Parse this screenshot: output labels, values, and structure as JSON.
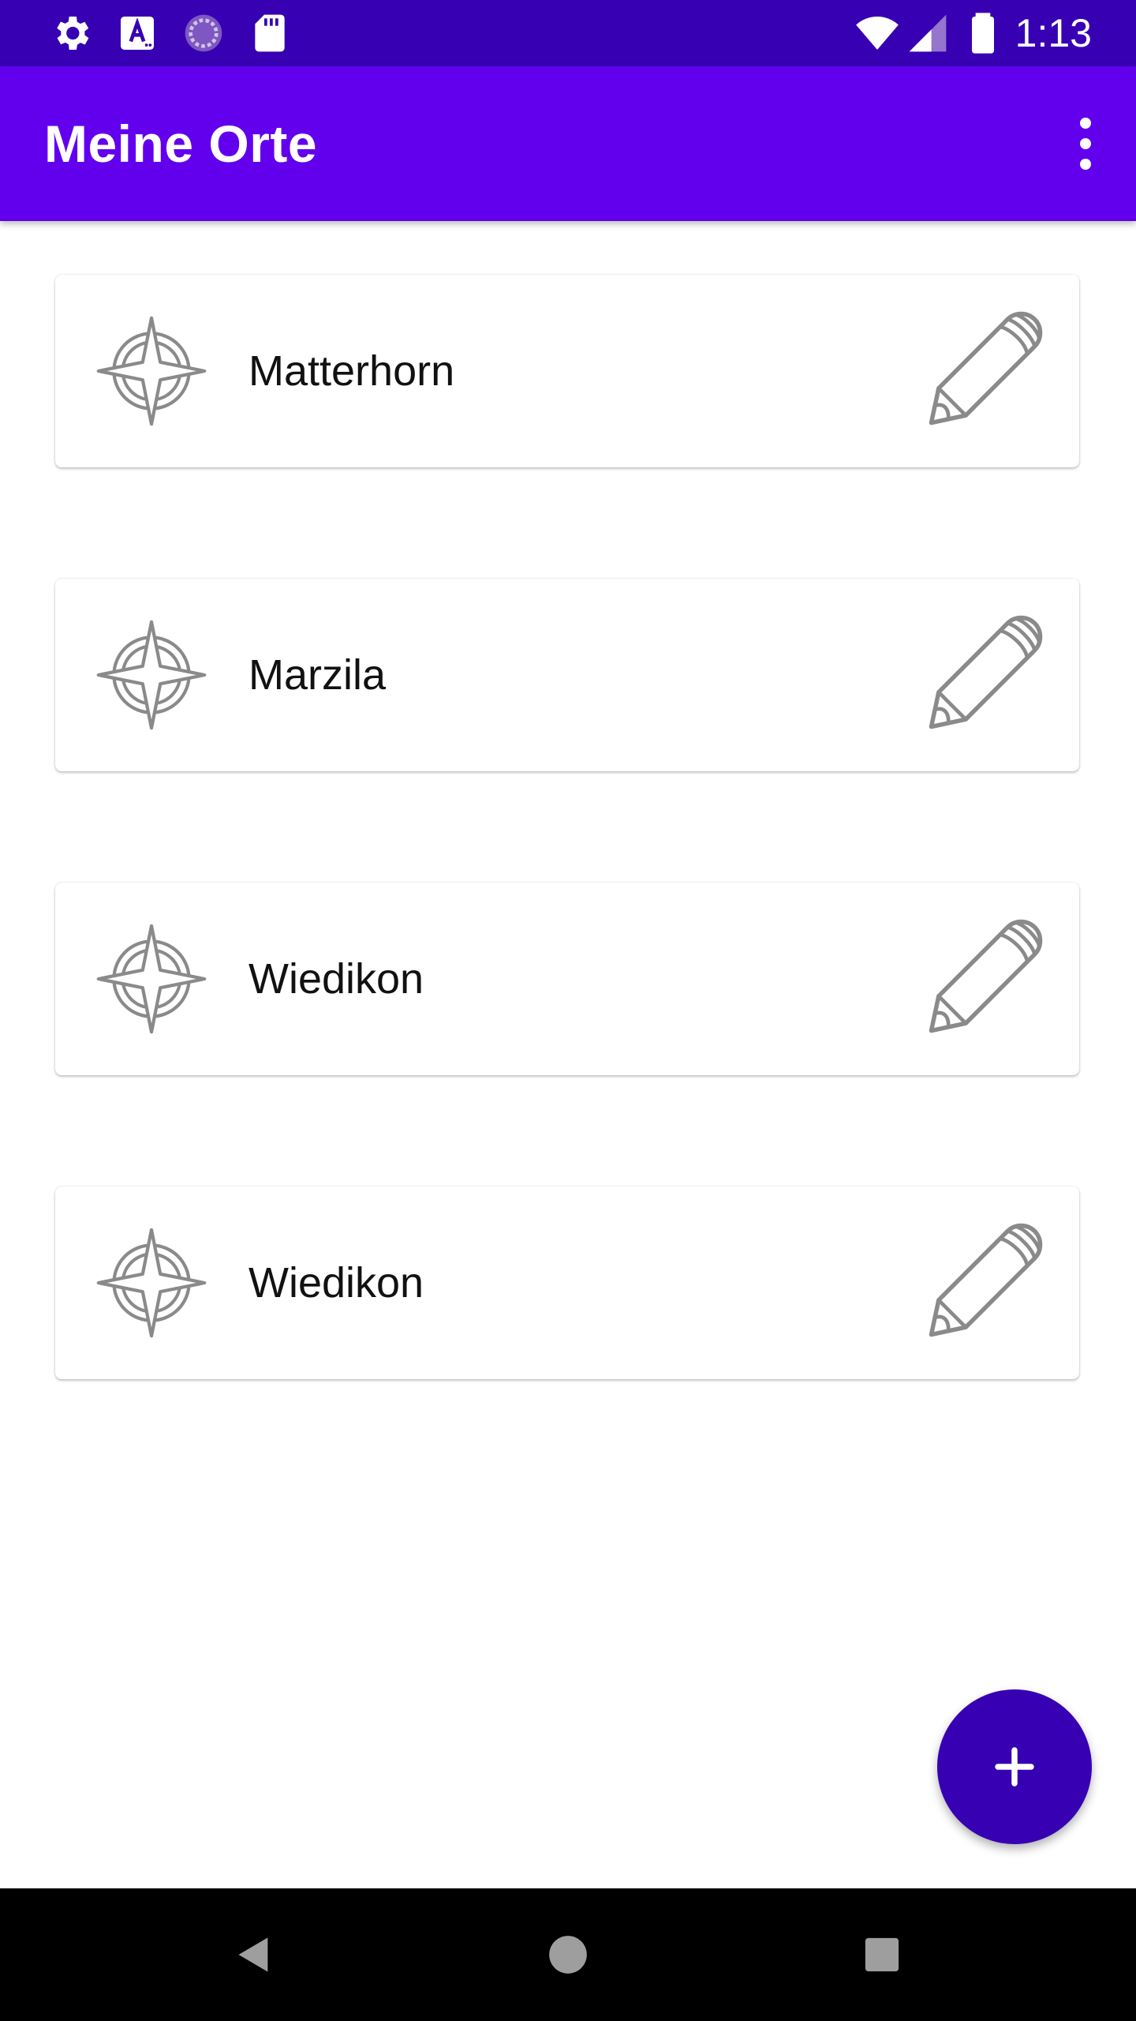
{
  "status_bar": {
    "time": "1:13",
    "icons": [
      "settings-icon",
      "font-a-icon",
      "sync-circle-icon",
      "sd-card-icon",
      "wifi-icon",
      "cell-signal-icon",
      "battery-icon"
    ]
  },
  "app_bar": {
    "title": "Meine Orte",
    "overflow_icon": "more-vert-icon"
  },
  "places": [
    {
      "name": "Matterhorn"
    },
    {
      "name": "Marzila"
    },
    {
      "name": "Wiedikon"
    },
    {
      "name": "Wiedikon"
    }
  ],
  "icons": {
    "place": "compass-icon",
    "edit": "pencil-icon",
    "add": "plus-icon"
  },
  "colors": {
    "status_bar": "#3700b3",
    "app_bar": "#6200ee",
    "fab": "#3700b3",
    "icon_gray": "#8a8a8a"
  },
  "nav_bar": {
    "icons": [
      "back-icon",
      "home-icon",
      "recents-icon"
    ]
  }
}
